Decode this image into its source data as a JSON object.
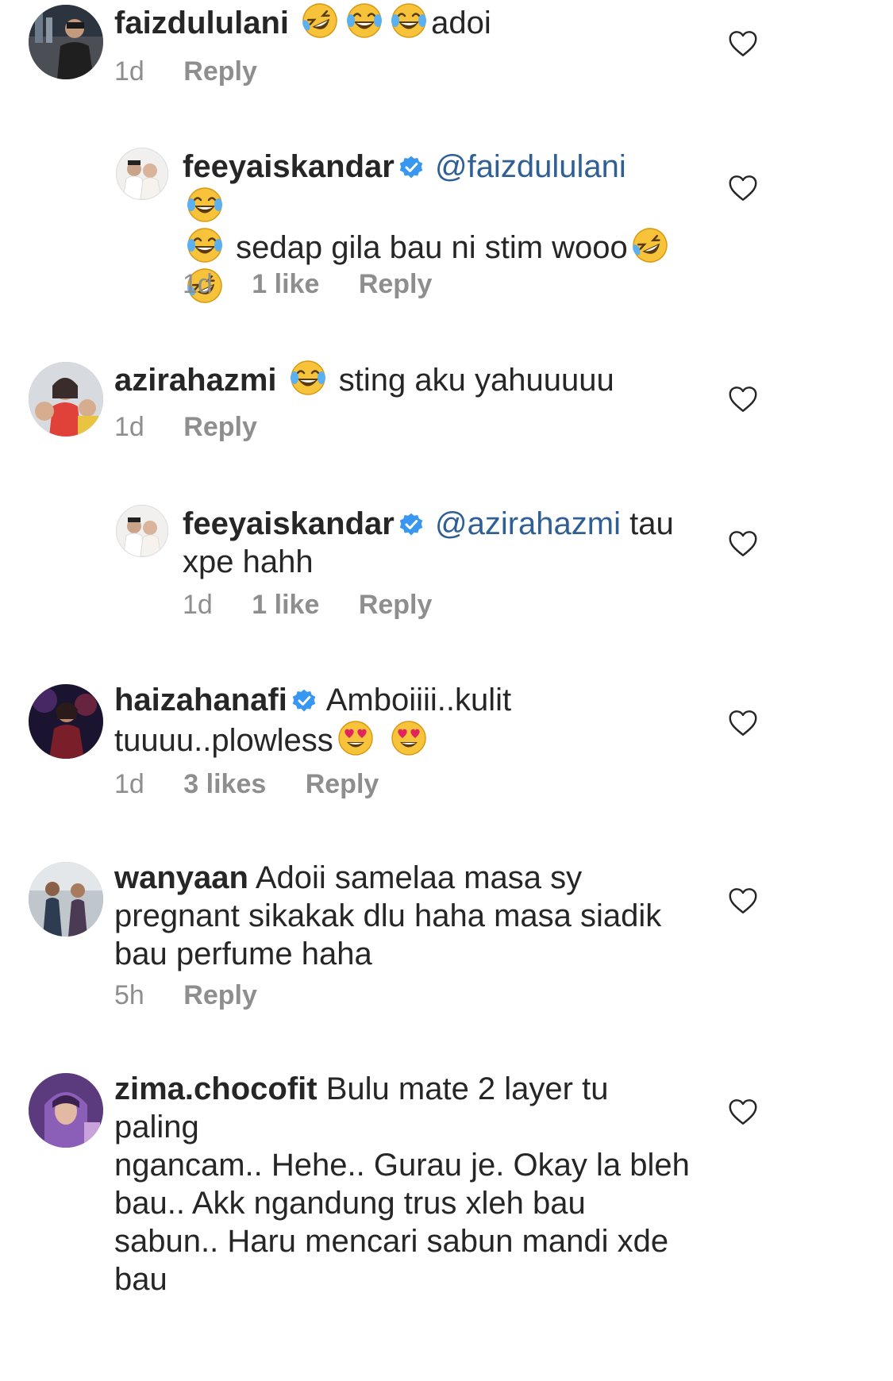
{
  "comments": [
    {
      "username": "faizdululani",
      "text_after": "adoi",
      "emojis_before": [
        "rofl",
        "joy",
        "joy"
      ],
      "time": "1d",
      "reply": "Reply"
    },
    {
      "username": "feeyaiskandar",
      "verified": true,
      "mention": "@faizdululani",
      "line2_text": "sedap gila bau ni stim wooo",
      "time": "1d",
      "likes": "1 like",
      "reply": "Reply"
    },
    {
      "username": "azirahazmi",
      "text": "sting aku yahuuuuu",
      "time": "1d",
      "reply": "Reply"
    },
    {
      "username": "feeyaiskandar",
      "verified": true,
      "mention": "@azirahazmi",
      "text_inline": "tau",
      "line2_text": "xpe hahh",
      "time": "1d",
      "likes": "1 like",
      "reply": "Reply"
    },
    {
      "username": "haizahanafi",
      "verified": true,
      "text_line1": "Amboiiii..kulit",
      "text_line2": "tuuuu..plowless",
      "time": "1d",
      "likes": "3 likes",
      "reply": "Reply"
    },
    {
      "username": "wanyaan",
      "text_line1": "Adoii samelaa masa sy",
      "text_line2": "pregnant sikakak dlu haha masa siadik",
      "text_line3": "bau perfume haha",
      "time": "5h",
      "reply": "Reply"
    },
    {
      "username": "zima.chocofit",
      "text_line1": "Bulu mate 2 layer tu paling",
      "text_line2": "ngancam.. Hehe.. Gurau je. Okay la bleh",
      "text_line3": "bau.. Akk ngandung trus xleh bau",
      "text_line4": "sabun.. Haru mencari sabun mandi xde",
      "text_line5": "bau"
    }
  ],
  "icons": {
    "like": "heart-outline-icon",
    "verified": "verified-badge-icon"
  },
  "colors": {
    "text": "#262626",
    "meta": "#8e8e8e",
    "mention": "#2f5f95",
    "verified": "#3897f0"
  }
}
